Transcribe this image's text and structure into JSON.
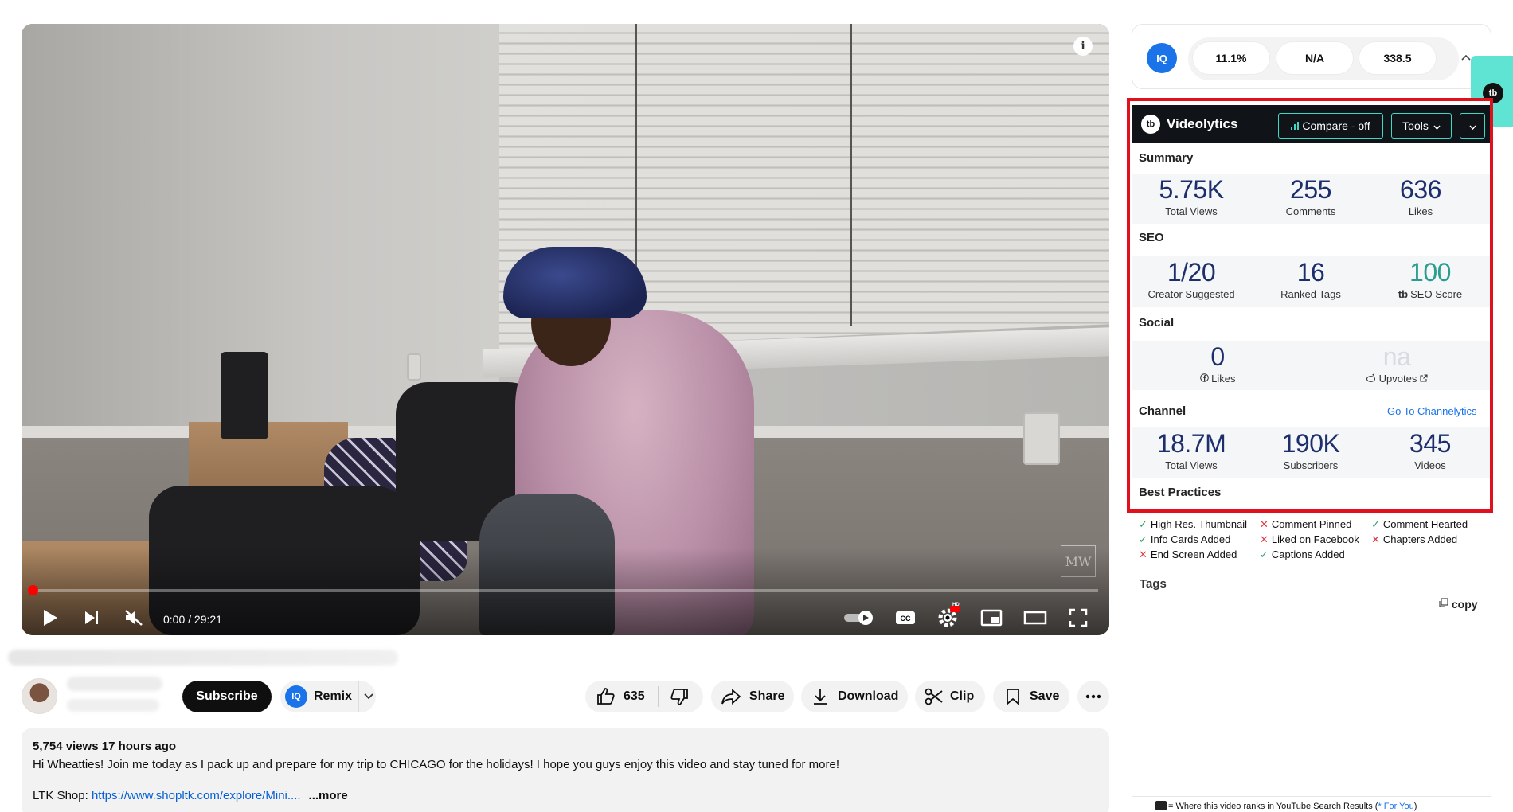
{
  "player": {
    "time": "0:00 / 29:21",
    "info_glyph": "i",
    "watermark": "MW",
    "hd_badge": "HD"
  },
  "actions": {
    "subscribe": "Subscribe",
    "remix": "Remix",
    "remix_logo": "IQ",
    "likes": "635",
    "share": "Share",
    "download": "Download",
    "clip": "Clip",
    "save": "Save"
  },
  "description": {
    "meta": "5,754 views  17 hours ago",
    "text": "Hi Wheatties! Join me today as I pack up and prepare for my trip to CHICAGO for the holidays! I hope you guys enjoy this video and stay tuned for more!",
    "link_prefix": "LTK Shop: ",
    "link": "https://www.shopltk.com/explore/Mini....",
    "more": "...more"
  },
  "iq_bar": {
    "logo": "IQ",
    "stats": [
      "11.1%",
      "N/A",
      "338.5"
    ]
  },
  "tb_logo": "tb",
  "videolytics": {
    "title": "Videolytics",
    "logo": "tb",
    "compare": "Compare - off",
    "tools": "Tools",
    "summary": {
      "title": "Summary",
      "items": [
        {
          "value": "5.75K",
          "label": "Total Views"
        },
        {
          "value": "255",
          "label": "Comments"
        },
        {
          "value": "636",
          "label": "Likes"
        }
      ]
    },
    "seo": {
      "title": "SEO",
      "items": [
        {
          "value": "1/20",
          "label": "Creator Suggested"
        },
        {
          "value": "16",
          "label": "Ranked Tags"
        },
        {
          "value": "100",
          "label": "SEO Score"
        }
      ]
    },
    "social": {
      "title": "Social",
      "items": [
        {
          "value": "0",
          "label": "Likes"
        },
        {
          "value": "na",
          "label": "Upvotes"
        }
      ]
    },
    "channel": {
      "title": "Channel",
      "link": "Go To Channelytics",
      "items": [
        {
          "value": "18.7M",
          "label": "Total Views"
        },
        {
          "value": "190K",
          "label": "Subscribers"
        },
        {
          "value": "345",
          "label": "Videos"
        }
      ]
    },
    "best_practices": {
      "title": "Best Practices",
      "items": [
        {
          "label": "High Res. Thumbnail",
          "ok": true
        },
        {
          "label": "Comment Pinned",
          "ok": false
        },
        {
          "label": "Comment Hearted",
          "ok": true
        },
        {
          "label": "Info Cards Added",
          "ok": true
        },
        {
          "label": "Liked on Facebook",
          "ok": false
        },
        {
          "label": "Chapters Added",
          "ok": false
        },
        {
          "label": "End Screen Added",
          "ok": false
        },
        {
          "label": "Captions Added",
          "ok": true
        }
      ]
    },
    "tags": {
      "title": "Tags",
      "copy": "copy"
    },
    "footer": {
      "text": "= Where this video ranks in YouTube Search Results (",
      "link": "* For You",
      "close": ")"
    }
  }
}
